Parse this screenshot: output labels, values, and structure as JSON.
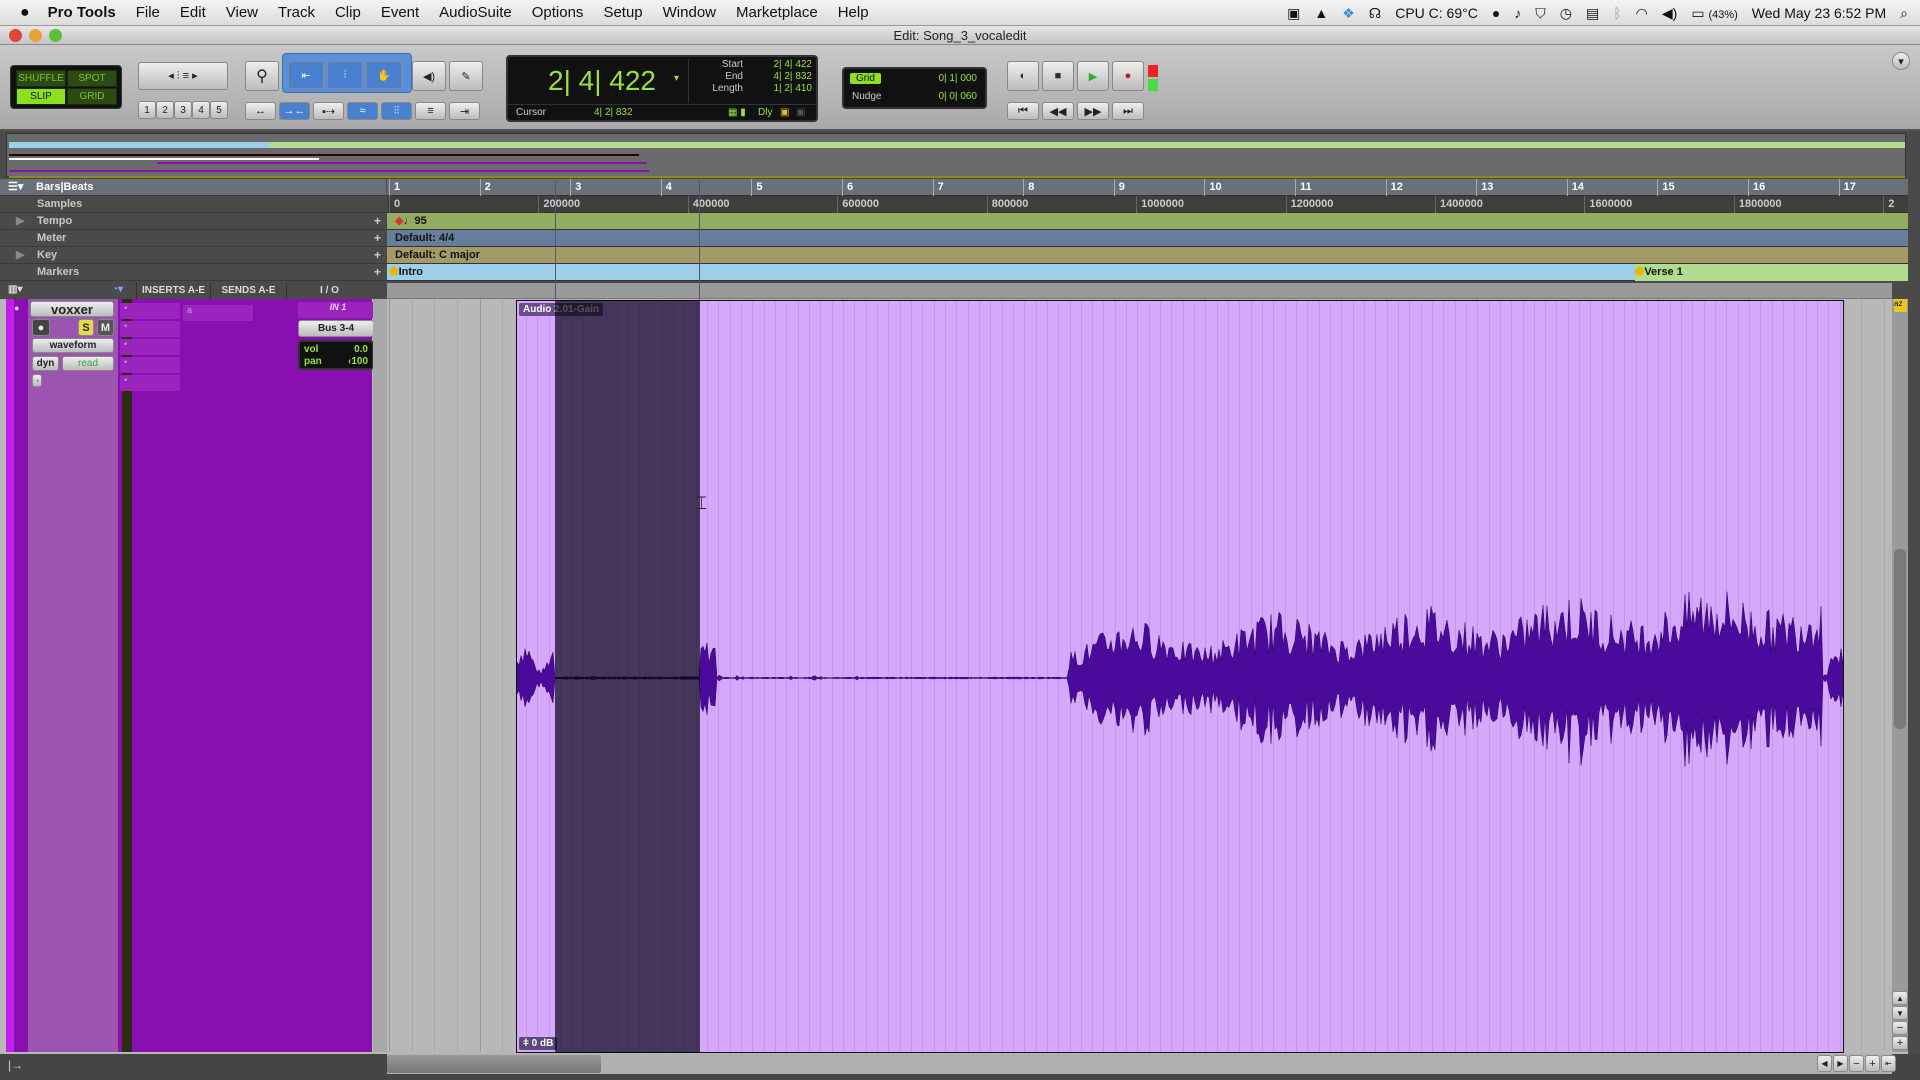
{
  "menu": {
    "app": "Pro Tools",
    "items": [
      "File",
      "Edit",
      "View",
      "Track",
      "Clip",
      "Event",
      "AudioSuite",
      "Options",
      "Setup",
      "Window",
      "Marketplace",
      "Help"
    ]
  },
  "status": {
    "cpu": "CPU C: 69°C",
    "battery": "(43%)",
    "datetime": "Wed May 23  6:52 PM"
  },
  "window": {
    "title": "Edit: Song_3_vocaledit"
  },
  "modes": {
    "shuffle": "SHUFFLE",
    "spot": "SPOT",
    "slip": "SLIP",
    "grid": "GRID",
    "active": "SLIP"
  },
  "zoom_presets": [
    "1",
    "2",
    "3",
    "4",
    "5"
  ],
  "counter": {
    "main": "2| 4| 422",
    "start_label": "Start",
    "start": "2| 4| 422",
    "end_label": "End",
    "end": "4| 2| 832",
    "length_label": "Length",
    "length": "1| 2| 410",
    "cursor_label": "Cursor",
    "cursor": "4| 2| 832",
    "dly": "Dly"
  },
  "grid": {
    "grid_label": "Grid",
    "grid_value": "0| 1| 000",
    "nudge_label": "Nudge",
    "nudge_value": "0| 0| 060"
  },
  "rulers": {
    "bars_label": "Bars|Beats",
    "samples_label": "Samples",
    "tempo_label": "Tempo",
    "meter_label": "Meter",
    "key_label": "Key",
    "markers_label": "Markers",
    "bars": [
      "1",
      "2",
      "3",
      "4",
      "5",
      "6",
      "7",
      "8",
      "9",
      "10",
      "11",
      "12",
      "13",
      "14",
      "15",
      "16",
      "17"
    ],
    "samples": [
      "0",
      "200000",
      "400000",
      "600000",
      "800000",
      "1000000",
      "1200000",
      "1400000",
      "1600000",
      "1800000",
      "2"
    ],
    "tempo": "95",
    "meter": "Default: 4/4",
    "key": "Default: C major",
    "markers": [
      {
        "name": "Intro",
        "bar": 1
      },
      {
        "name": "Verse 1",
        "bar": 14.75
      }
    ]
  },
  "track_columns": {
    "inserts": "INSERTS A-E",
    "sends": "SENDS A-E",
    "io": "I / O"
  },
  "track": {
    "name": "voxxer",
    "solo": "S",
    "mute": "M",
    "view": "waveform",
    "dyn": "dyn",
    "automation": "read",
    "send_a": "a",
    "input": "IN 1",
    "output": "Bus 3-4",
    "vol_label": "vol",
    "vol": "0.0",
    "pan_label": "pan",
    "pan": "‹100"
  },
  "clip": {
    "name": "Audio 2.01-Gain",
    "gain": "0 dB"
  },
  "colors": {
    "track": "#8a0fb0",
    "clip": "#d6a8fc",
    "waveform": "#4b0a9c",
    "selection": "#35323f",
    "lcd": "#9be13c"
  }
}
